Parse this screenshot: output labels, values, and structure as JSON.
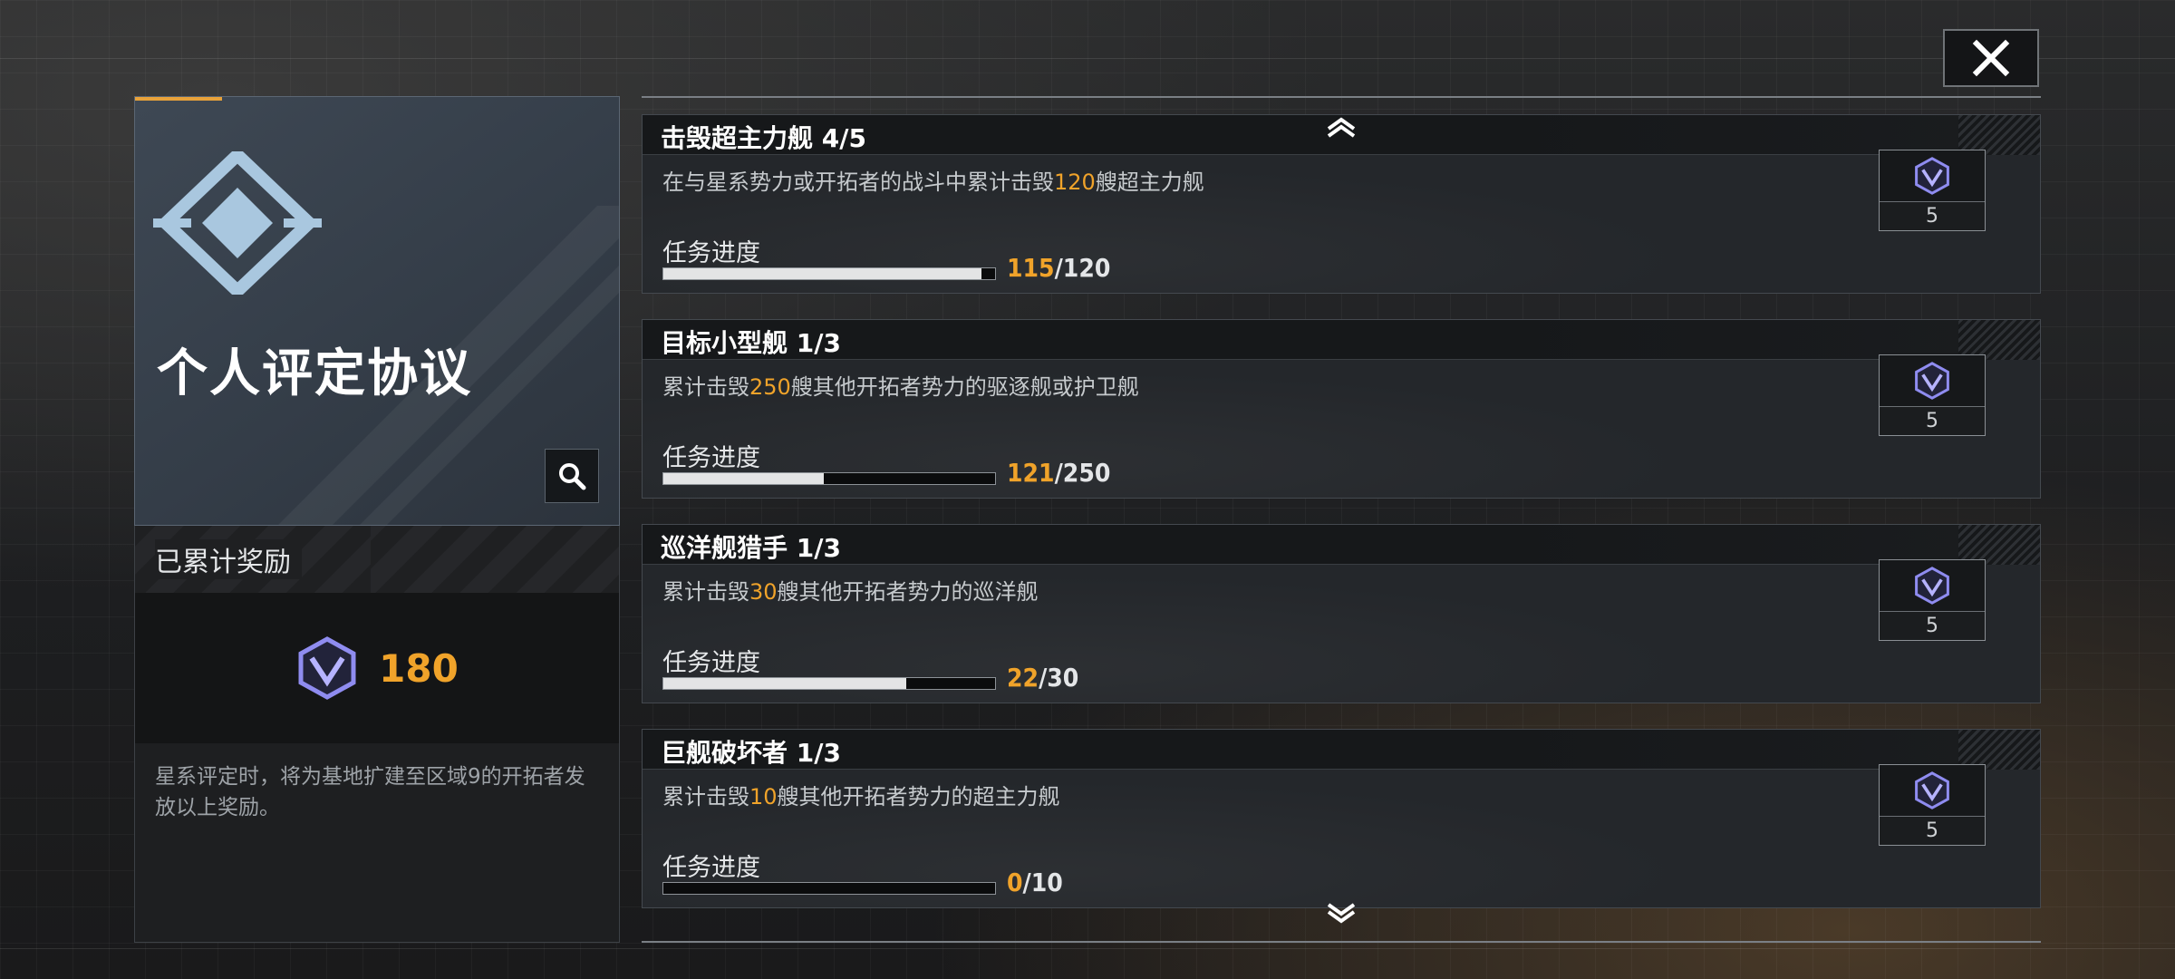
{
  "close_button": {
    "icon": "close-icon"
  },
  "left_panel": {
    "title": "个人评定协议",
    "logo_icon": "protocol-diamond-emblem",
    "search_icon": "magnifier-icon",
    "accumulated_label": "已累计奖励",
    "accumulated_amount": "180",
    "currency_icon": "v-shield-currency-icon",
    "note": "星系评定时，将为基地扩建至区域9的开拓者发放以上奖励。"
  },
  "scroll": {
    "up_icon": "chevron-up-icon",
    "down_icon": "chevron-down-icon"
  },
  "progress_label": "任务进度",
  "missions": [
    {
      "title": "击毁超主力舰 4/5",
      "desc_before": "在与星系势力或开拓者的战斗中累计击毁",
      "desc_highlight": "120",
      "desc_after": "艘超主力舰",
      "current": "115",
      "total": "/120",
      "progress": 0.958,
      "reward_count": "5"
    },
    {
      "title": "目标小型舰 1/3",
      "desc_before": "累计击毁",
      "desc_highlight": "250",
      "desc_after": "艘其他开拓者势力的驱逐舰或护卫舰",
      "current": "121",
      "total": "/250",
      "progress": 0.484,
      "reward_count": "5"
    },
    {
      "title": "巡洋舰猎手 1/3",
      "desc_before": "累计击毁",
      "desc_highlight": "30",
      "desc_after": "艘其他开拓者势力的巡洋舰",
      "current": "22",
      "total": "/30",
      "progress": 0.733,
      "reward_count": "5"
    },
    {
      "title": "巨舰破坏者 1/3",
      "desc_before": "累计击毁",
      "desc_highlight": "10",
      "desc_after": "艘其他开拓者势力的超主力舰",
      "current": "0",
      "total": "/10",
      "progress": 0.0,
      "reward_count": "5"
    }
  ],
  "colors": {
    "accent": "#f0a32a",
    "currency": "#8f8cf0",
    "panel": "#343d48"
  }
}
